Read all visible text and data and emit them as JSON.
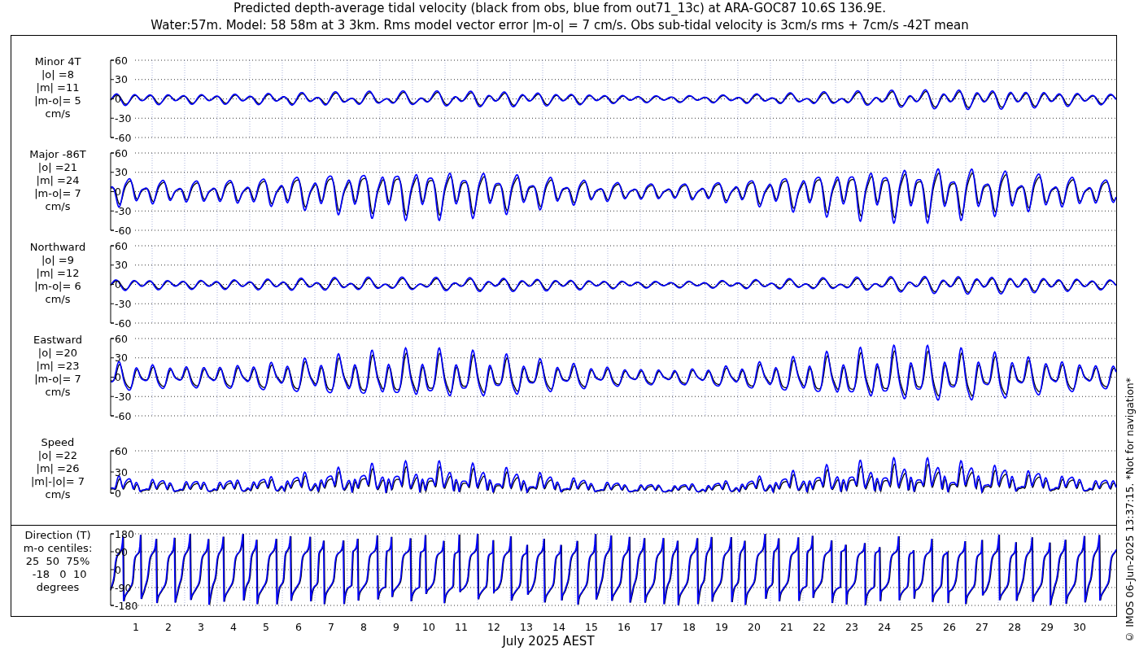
{
  "title": [
    "Predicted depth-average tidal velocity (black from obs, blue from out71_13c) at ARA-GOC87 10.6S 136.9E.",
    "Water:57m. Model: 58 58m at 3 3km. Rms model vector error |m-o| = 7 cm/s. Obs sub-tidal velocity is 3cm/s rms + 7cm/s -42T mean"
  ],
  "panels": [
    {
      "kind": "minor",
      "label": [
        "Minor 4T",
        "|o| =8",
        "|m| =11",
        "|m-o|= 5",
        "cm/s"
      ],
      "y_tick_labels": [
        "60",
        "30",
        "0",
        "-30",
        "-60"
      ]
    },
    {
      "kind": "major",
      "label": [
        "Major -86T",
        "|o| =21",
        "|m| =24",
        "|m-o|= 7",
        "cm/s"
      ],
      "y_tick_labels": [
        "60",
        "30",
        "0",
        "-30",
        "-60"
      ]
    },
    {
      "kind": "north",
      "label": [
        "Northward",
        "|o| =9",
        "|m| =12",
        "|m-o|= 6",
        "cm/s"
      ],
      "y_tick_labels": [
        "60",
        "30",
        "0",
        "-30",
        "-60"
      ]
    },
    {
      "kind": "east",
      "label": [
        "Eastward",
        "|o| =20",
        "|m| =23",
        "|m-o|= 7",
        "cm/s"
      ],
      "y_tick_labels": [
        "60",
        "30",
        "0",
        "-30",
        "-60"
      ]
    },
    {
      "kind": "speed",
      "label": [
        "Speed",
        "|o| =22",
        "|m| =26",
        "|m|-|o|= 7",
        "cm/s"
      ],
      "y_tick_labels": [
        "60",
        "30",
        "0"
      ]
    },
    {
      "kind": "direction",
      "label": [
        "Direction (T)",
        "m-o centiles:",
        "25  50  75%",
        " -18   0  10",
        "degrees"
      ],
      "y_tick_labels": [
        "180",
        "90",
        "0",
        "-90",
        "-180"
      ]
    }
  ],
  "x_axis": {
    "title": "July 2025 AEST",
    "ticks": [
      "1",
      "2",
      "3",
      "4",
      "5",
      "6",
      "7",
      "8",
      "9",
      "10",
      "11",
      "12",
      "13",
      "14",
      "15",
      "16",
      "17",
      "18",
      "19",
      "20",
      "21",
      "22",
      "23",
      "24",
      "25",
      "26",
      "27",
      "28",
      "29",
      "30"
    ]
  },
  "side_note": "© IMOS 06-Jun-2025 13:37:15. *Not for navigation*"
}
